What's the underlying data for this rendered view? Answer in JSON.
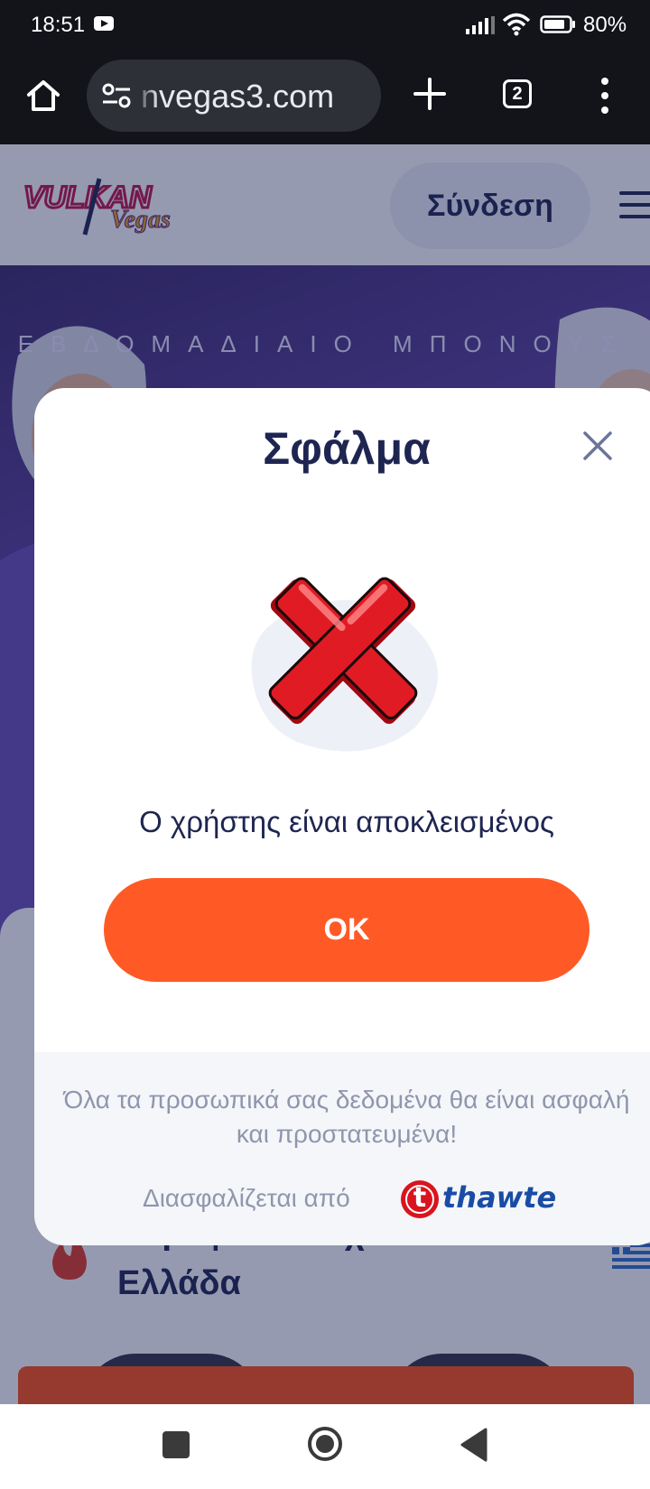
{
  "status_bar": {
    "time": "18:51",
    "battery": "80%",
    "icons": [
      "youtube-icon",
      "signal-icon",
      "wifi-icon",
      "battery-icon"
    ]
  },
  "browser": {
    "url": "nvegas3.com",
    "tab_count": "2",
    "icons": [
      "home-icon",
      "site-settings-icon",
      "new-tab-icon",
      "tabs-icon",
      "menu-icon"
    ]
  },
  "site": {
    "logo_text": "VULKAN Vegas",
    "login_label": "Σύνδεση",
    "hero_text": "ΕΒΔΟΜΑΔΙΑΙΟ ΜΠΟΝΟΥΣ",
    "section_title": "Κορυφαία Παιχνίδια σε Ελλάδα"
  },
  "modal": {
    "title": "Σφάλμα",
    "message": "Ο χρήστης είναι αποκλεισμένος",
    "ok_label": "OK",
    "privacy_text": "Όλα τα προσωπικά σας δεδομένα θα είναι ασφαλή και προστατευμένα!",
    "secured_by": "Διασφαλίζεται από",
    "security_brand": "thawte"
  },
  "colors": {
    "accent": "#ff5a26",
    "navy": "#1e2551",
    "error_red": "#e01b24"
  }
}
